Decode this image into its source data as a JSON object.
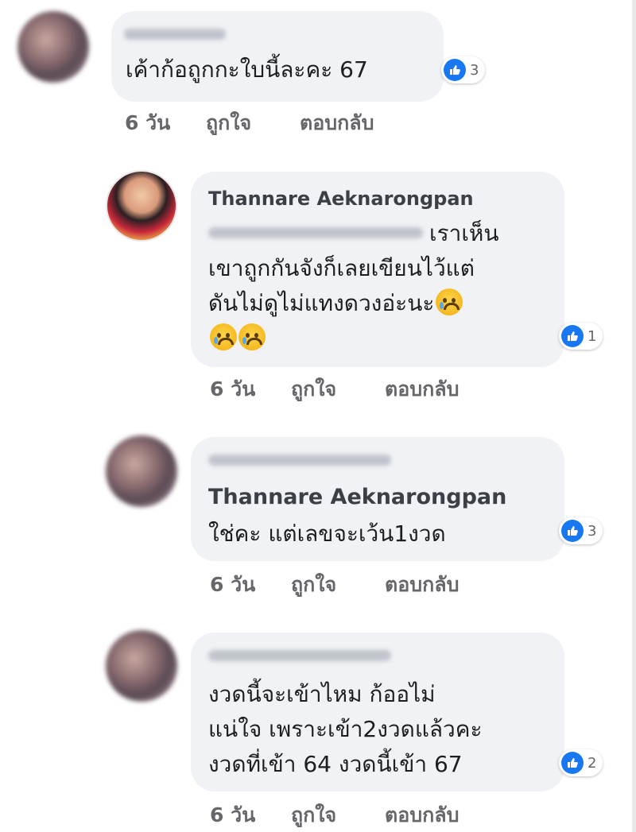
{
  "colors": {
    "bubble": "#f0f2f5",
    "like_blue": "#1877f2",
    "meta_gray": "#65676b"
  },
  "comments": [
    {
      "text_lines": [
        "เค้าก้อถูกกะใบนี้ละคะ 67"
      ],
      "reactions": "3",
      "time": "6 วัน",
      "like": "ถูกใจ",
      "reply": "ตอบกลับ"
    },
    {
      "author": "Thannare Aeknarongpan",
      "text_lines": [
        "เราเห็น",
        "เขาถูกกันจังก็เลยเขียนไว้แต่",
        "ดันไม่ดูไม่แทงดวงอ่ะนะ"
      ],
      "reactions": "1",
      "time": "6 วัน",
      "like": "ถูกใจ",
      "reply": "ตอบกลับ"
    },
    {
      "mention": "Thannare Aeknarongpan",
      "text_lines": [
        "ใช่คะ แต่เลขจะเว้น1งวด"
      ],
      "reactions": "3",
      "time": "6 วัน",
      "like": "ถูกใจ",
      "reply": "ตอบกลับ"
    },
    {
      "text_lines": [
        "งวดนี้จะเข้าไหม ก้ออไม่",
        "แน่ใจ เพราะเข้า2งวดแล้วคะ",
        "งวดที่เข้า 64 งวดนี้เข้า 67"
      ],
      "reactions": "2",
      "time": "6 วัน",
      "like": "ถูกใจ",
      "reply": "ตอบกลับ"
    }
  ]
}
